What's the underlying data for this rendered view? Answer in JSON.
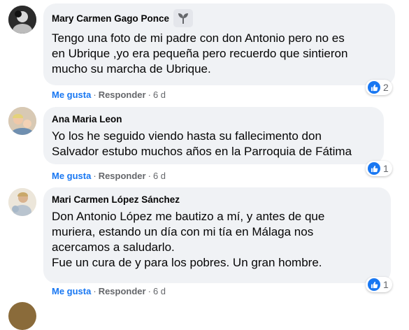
{
  "comments": [
    {
      "author": "Mary Carmen Gago Ponce",
      "text": "Tengo una foto de mi padre con don Antonio pero no es\nen Ubrique ,yo era pequeña pero recuerdo que sintieron\nmucho su marcha de Ubrique.",
      "like_label": "Me gusta",
      "reply_label": "Responder",
      "time": "6 d",
      "reaction_count": "2",
      "badge_icon": "sprout-icon"
    },
    {
      "author": "Ana Maria Leon",
      "text": "Yo los he seguido viendo hasta su fallecimento don\nSalvador estubo muchos años en la Parroquia de Fátima",
      "like_label": "Me gusta",
      "reply_label": "Responder",
      "time": "6 d",
      "reaction_count": "1"
    },
    {
      "author": "Mari Carmen López Sánchez",
      "text": "Don Antonio López me bautizo a mí, y antes de que\nmuriera, estando un día con mi tía en Málaga nos\nacercamos a saludarlo.\nFue un cura de y para los pobres. Un gran hombre.",
      "like_label": "Me gusta",
      "reply_label": "Responder",
      "time": "6 d",
      "reaction_count": "1"
    }
  ],
  "colors": {
    "bubble": "#f0f2f5",
    "link_blue": "#1877f2",
    "meta_gray": "#65676b"
  }
}
